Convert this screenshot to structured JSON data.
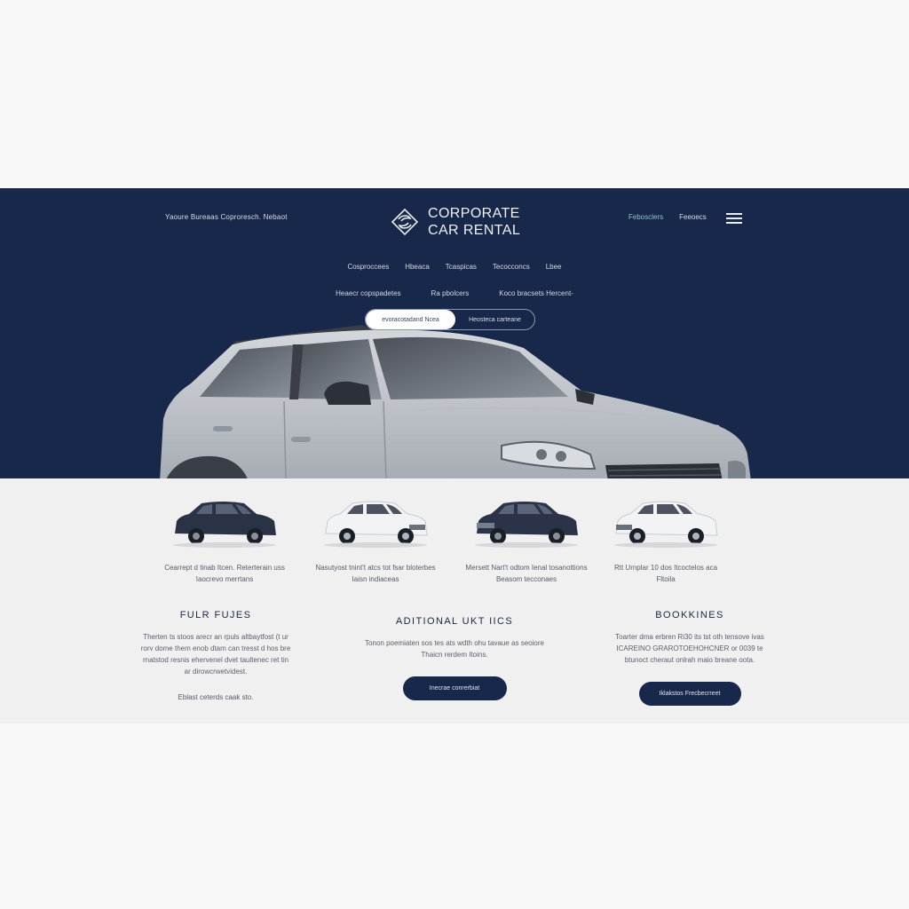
{
  "header": {
    "tagline": "Yaoure Bureaas Coproresch. Nebaot",
    "logo_line1": "CORPORATE",
    "logo_line2": "CAR RENTAL",
    "links": [
      "Febosclers",
      "Feeoecs"
    ]
  },
  "nav": {
    "row1": [
      "Cosproccees",
      "Hbeaca",
      "Tcaspicas",
      "Tecocconcs",
      "Lbee"
    ],
    "row2": [
      "Heaecr copspadetes",
      "Ra pbolcers",
      "Koco bracsets Hercent-"
    ]
  },
  "segmented": {
    "options": [
      "evoracotadand Ncea",
      "Heosteca carteane"
    ],
    "active_index": 0
  },
  "fleet": [
    {
      "caption_line1": "Cearrept d tinab Itcen. Reterterain uss",
      "caption_line2": "Iaocrevo merrtans",
      "color": "#2a3346"
    },
    {
      "caption_line1": "Nasutyost tnint't atcs tot fsar bloterbes",
      "caption_line2": "Iaisn indiaceas",
      "color": "#f2f3f5"
    },
    {
      "caption_line1": "Mersett Nart't odtom Ienal tosanottions",
      "caption_line2": "Beasom tecconaes",
      "color": "#2b3348"
    },
    {
      "caption_line1": "Rtt Urnplar 10 dos Itcoctelos aca",
      "caption_line2": "Fltoila",
      "color": "#f2f3f5"
    }
  ],
  "features": {
    "title": "FULR FUJES",
    "body": [
      "Therten ts stoos arecr an rpuls altbaytfost (t ur",
      "rorv dome them enob dtam can tresst d hos bre",
      "rnatstod resnis ehervenel dvet taultenec ret tin",
      "ar dirowcrwetvidest."
    ],
    "footnote": "Eblast ceterds caak sto."
  },
  "additional": {
    "title": "ADITIONAL UKT IICS",
    "body": [
      "Tonon poemiaten sos tes ats wdth ohu tavaue as seoiore",
      "Thaicn rerdem Itoins."
    ],
    "button": "Inecrae conrerbiat"
  },
  "bookings": {
    "title": "BOOKKINES",
    "body": [
      "Toarter dma erbren Ri30 its tst oth tensove ivas",
      "ICAREINO GRAROTOEHOHCNER or 0039 te",
      "btunoct cheraut onlrah maio breane oota."
    ],
    "button": "Iklakstos Frecbecrreet"
  },
  "colors": {
    "navy": "#18284a",
    "accent_teal": "#8ec7c9",
    "light_bg": "#f0f0f1"
  }
}
